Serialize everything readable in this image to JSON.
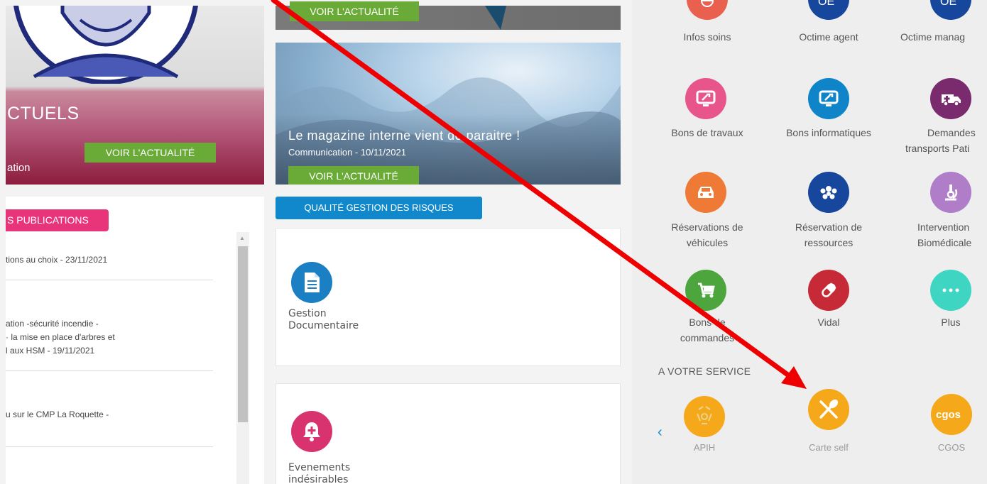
{
  "left": {
    "hero": {
      "title": "CTUELS",
      "subtitle": "ation",
      "button": "VOIR L'ACTUALITÉ"
    },
    "publications": {
      "tag": "S PUBLICATIONS",
      "items": [
        {
          "lines": [
            "tions au choix - 23/11/2021"
          ]
        },
        {
          "lines": [
            "ation -sécurité incendie -",
            "· la mise en place d'arbres et",
            "l aux HSM - 19/11/2021"
          ]
        },
        {
          "lines": [
            "u sur le CMP La Roquette -"
          ]
        }
      ]
    }
  },
  "middle": {
    "top_button": "VOIR L'ACTUALITÉ",
    "magazine": {
      "title": "Le magazine interne vient de paraitre !",
      "subtitle": "Communication - 10/11/2021",
      "button": "VOIR L'ACTUALITÉ"
    },
    "quality_tag": "QUALITÉ GESTION DES RISQUES",
    "doc_card": {
      "label_1": "Gestion",
      "label_2": "Documentaire",
      "icon": "document-icon",
      "color": "#1b7fc4"
    },
    "events_card": {
      "label_1": "Evenements",
      "label_2": "indésirables",
      "icon": "bell-plus-icon",
      "color": "#d8336e"
    }
  },
  "right": {
    "apps_row0": [
      {
        "label": "Infos soins"
      },
      {
        "label": "Octime agent"
      },
      {
        "label": "Octime manag"
      }
    ],
    "apps_row1": [
      {
        "label": "Bons de travaux",
        "icon": "tools-monitor-icon",
        "color": "#e7558a"
      },
      {
        "label": "Bons informatiques",
        "icon": "tools-monitor-icon",
        "color": "#0f84c8"
      },
      {
        "label_1": "Demandes",
        "label_2": "transports Pati",
        "icon": "ambulance-icon",
        "color": "#7a2b6d"
      }
    ],
    "apps_row2": [
      {
        "label_1": "Réservations de",
        "label_2": "véhicules",
        "icon": "car-icon",
        "color": "#ef7a36"
      },
      {
        "label_1": "Réservation de",
        "label_2": "ressources",
        "icon": "people-icon",
        "color": "#17479d"
      },
      {
        "label_1": "Intervention",
        "label_2": "Biomédicale",
        "icon": "microscope-icon",
        "color": "#b07dc9"
      }
    ],
    "apps_row3": [
      {
        "label_1": "Bons de",
        "label_2": "commandes",
        "icon": "cart-icon",
        "color": "#4da63d"
      },
      {
        "label": "Vidal",
        "icon": "pill-icon",
        "color": "#c62a36"
      },
      {
        "label": "Plus",
        "icon": "more-dots-icon",
        "color": "#3ed6c3"
      }
    ],
    "section_title": "A VOTRE SERVICE",
    "services": [
      {
        "label": "APIH",
        "icon": "apih-logo",
        "color": "#f6a81b"
      },
      {
        "label": "Carte self",
        "icon": "fork-spoon-icon",
        "color": "#f6a81b"
      },
      {
        "label": "CGOS",
        "logo_text": "cgos",
        "icon": "cgos-logo",
        "color": "#f6a81b"
      }
    ]
  }
}
